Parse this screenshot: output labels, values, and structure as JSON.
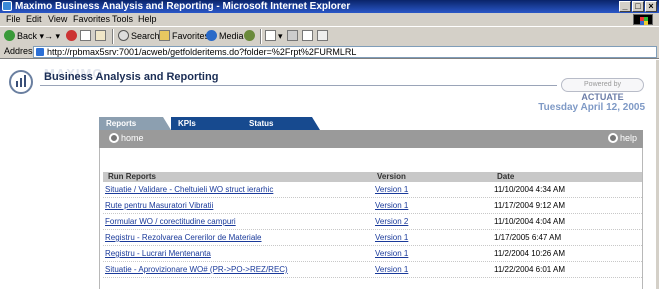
{
  "window": {
    "title": "Maximo Business Analysis and Reporting - Microsoft Internet Explorer"
  },
  "menu": [
    "File",
    "Edit",
    "View",
    "Favorites",
    "Tools",
    "Help"
  ],
  "toolbar": {
    "back": "Back",
    "search": "Search",
    "favorites": "Favorites",
    "media": "Media"
  },
  "address": {
    "label": "Address",
    "url": "http://rpbmax5srv:7001/acweb/getfolderitems.do?folder=%2Frpt%2FURMLRL"
  },
  "app": {
    "title": "Business Analysis and Reporting",
    "powered_by": "Powered by",
    "powered_brand": "ACTUATE",
    "date": "Tuesday April 12, 2005"
  },
  "tabs": [
    "Reports",
    "KPIs",
    "Status"
  ],
  "nav": {
    "home": "home",
    "help": "help"
  },
  "table": {
    "columns": [
      "Run Reports",
      "Version",
      "Date"
    ],
    "rows": [
      {
        "name": "Situatie / Validare - Cheltuieli WO struct ierarhic",
        "version": "Version 1",
        "date": "11/10/2004 4:34 AM"
      },
      {
        "name": "Rute pentru Masuratori Vibratii",
        "version": "Version 1",
        "date": "11/17/2004 9:12 AM"
      },
      {
        "name": "Formular WO / corectitudine campuri",
        "version": "Version 2",
        "date": "11/10/2004 4:04 AM"
      },
      {
        "name": "Registru - Rezolvarea Cererilor de Materiale",
        "version": "Version 1",
        "date": "1/17/2005 6:47 AM"
      },
      {
        "name": "Registru - Lucrari Mentenanta",
        "version": "Version 1",
        "date": "11/2/2004 10:26 AM"
      },
      {
        "name": "Situatie - Aprovizionare WO# (PR->PO->REZ/REC)",
        "version": "Version 1",
        "date": "11/22/2004 6:01 AM"
      }
    ]
  },
  "colors": {
    "titlebar": "#0a246a",
    "tab_dark": "#174a8f",
    "tab_active": "#8c9fb0",
    "link": "#1a3a9a",
    "date": "#7f9ac6"
  }
}
